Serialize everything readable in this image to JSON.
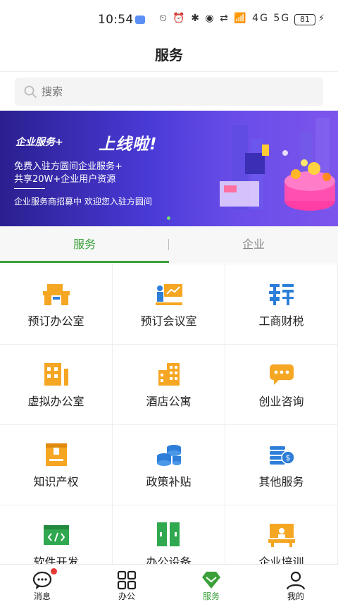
{
  "status_bar": {
    "time": "10:54",
    "icons": "⏲ ⏰ ✱ ◉ ⇄ 📶 4G 5G",
    "battery": "81"
  },
  "header": {
    "title": "服务"
  },
  "search": {
    "placeholder": "搜索"
  },
  "banner": {
    "subtitle": "企业服务+",
    "headline": "上线啦!",
    "line1": "免费入驻方圆间企业服务+",
    "line2": "共享20W+企业用户资源",
    "line3": "企业服务商招募中 欢迎您入驻方圆间"
  },
  "tabs": [
    {
      "label": "服务",
      "active": true
    },
    {
      "label": "企业",
      "active": false
    }
  ],
  "services": [
    {
      "label": "预订办公室",
      "icon": "office-desk-icon"
    },
    {
      "label": "预订会议室",
      "icon": "meeting-room-icon"
    },
    {
      "label": "工商财税",
      "icon": "tax-icon"
    },
    {
      "label": "虚拟办公室",
      "icon": "virtual-office-icon"
    },
    {
      "label": "酒店公寓",
      "icon": "hotel-icon"
    },
    {
      "label": "创业咨询",
      "icon": "chat-bubble-icon"
    },
    {
      "label": "知识产权",
      "icon": "ip-book-icon"
    },
    {
      "label": "政策补贴",
      "icon": "coins-icon"
    },
    {
      "label": "其他服务",
      "icon": "money-stack-icon"
    },
    {
      "label": "软件开发",
      "icon": "code-window-icon"
    },
    {
      "label": "办公设备",
      "icon": "cabinet-icon"
    },
    {
      "label": "企业培训",
      "icon": "training-icon"
    }
  ],
  "bottom_nav": [
    {
      "label": "消息",
      "icon": "message-icon",
      "badge": true
    },
    {
      "label": "办公",
      "icon": "grid-icon"
    },
    {
      "label": "服务",
      "icon": "service-diamond-icon",
      "active": true
    },
    {
      "label": "我的",
      "icon": "profile-icon"
    }
  ],
  "colors": {
    "accent_green": "#3aa13a",
    "icon_orange": "#f5a623",
    "icon_green": "#2fa84f",
    "icon_blue": "#2d7ed8",
    "badge_red": "#e53935"
  }
}
